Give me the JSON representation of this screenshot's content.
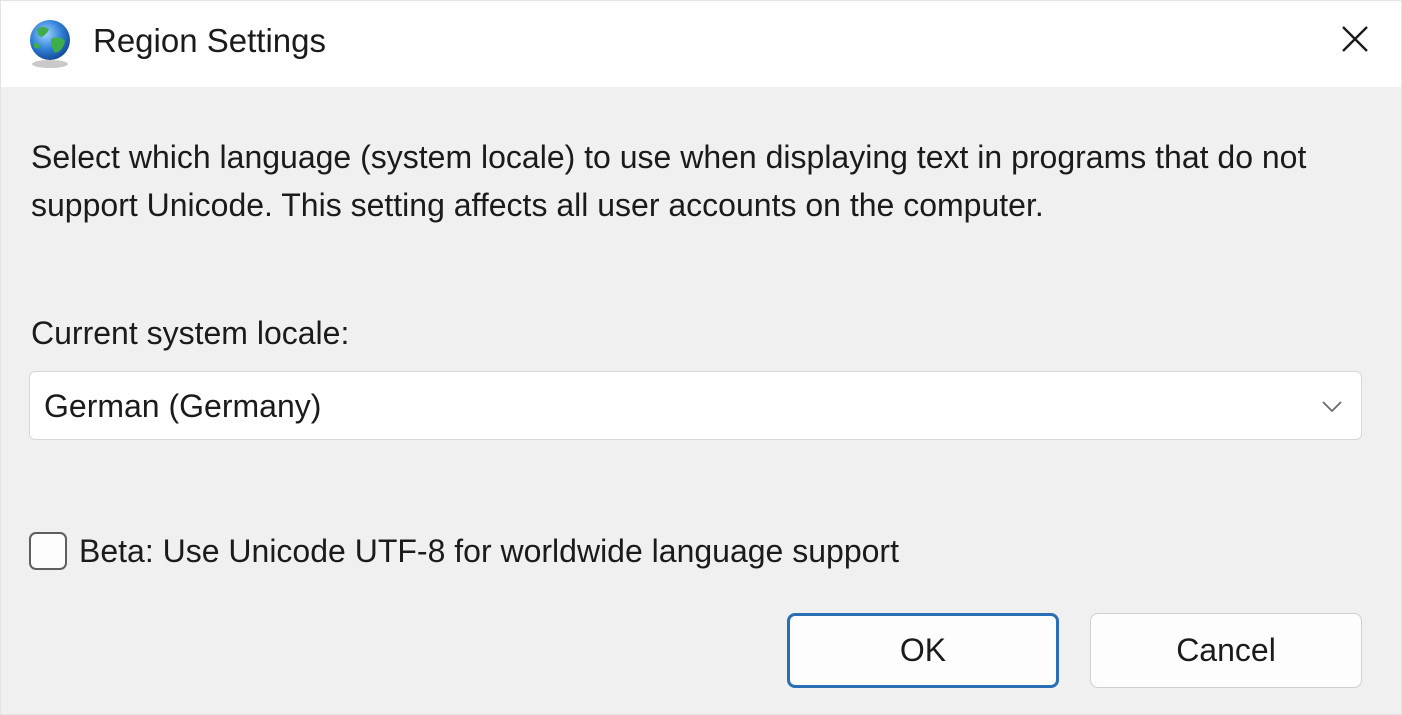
{
  "window": {
    "title": "Region Settings",
    "icon": "globe-icon",
    "close_icon": "close-icon"
  },
  "description": "Select which language (system locale) to use when displaying text in programs that do not support Unicode. This setting affects all user accounts on the computer.",
  "locale": {
    "label": "Current system locale:",
    "selected": "German (Germany)",
    "chevron_icon": "chevron-down-icon"
  },
  "beta_option": {
    "label": "Beta: Use Unicode UTF-8 for worldwide language support",
    "checked": false
  },
  "buttons": {
    "ok": "OK",
    "cancel": "Cancel"
  },
  "colors": {
    "ok_border": "#2a6fb5",
    "dialog_background": "#f0f0f0"
  }
}
